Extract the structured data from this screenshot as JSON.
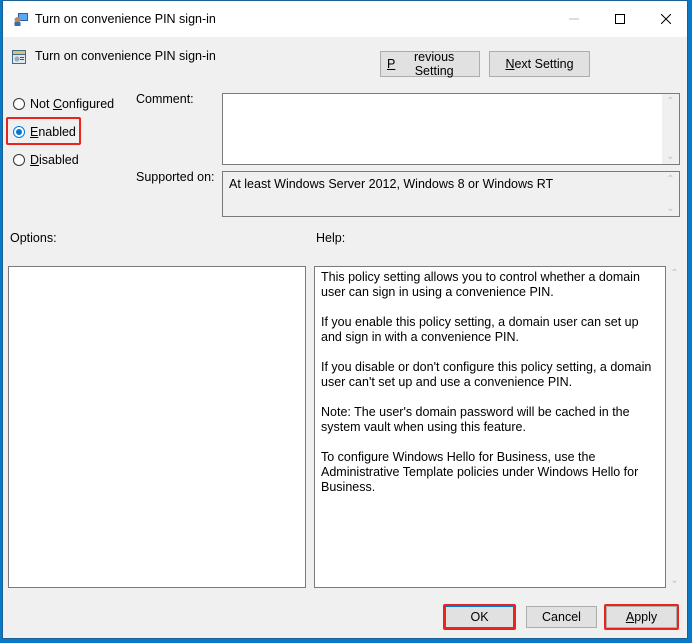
{
  "window": {
    "title": "Turn on convenience PIN sign-in",
    "title_icon": "policy-editor-icon",
    "controls": {
      "minimize": "minimize-icon",
      "maximize": "maximize-icon",
      "close": "close-icon"
    }
  },
  "header": {
    "title": "Turn on convenience PIN sign-in",
    "icon": "policy-setting-icon",
    "previous_label_prefix": "P",
    "previous_label_rest": "revious Setting",
    "next_label_prefix": "N",
    "next_label_rest": "ext Setting"
  },
  "state": {
    "options": [
      {
        "prefix": "Not ",
        "accel": "C",
        "rest": "onfigured",
        "checked": false
      },
      {
        "prefix": "",
        "accel": "E",
        "rest": "nabled",
        "checked": true
      },
      {
        "prefix": "",
        "accel": "D",
        "rest": "isabled",
        "checked": false
      }
    ]
  },
  "labels": {
    "comment": "Comment:",
    "supported_on": "Supported on:",
    "options": "Options:",
    "help": "Help:"
  },
  "comment_value": "",
  "supported_on_value": "At least Windows Server 2012, Windows 8 or Windows RT",
  "help_paragraphs": [
    "This policy setting allows you to control whether a domain user can sign in using a convenience PIN.",
    "If you enable this policy setting, a domain user can set up and sign in with a convenience PIN.",
    "If you disable or don't configure this policy setting, a domain user can't set up and use a convenience PIN.",
    "Note: The user's domain password will be cached in the system vault when using this feature.",
    "To configure Windows Hello for Business, use the Administrative Template policies under Windows Hello for Business."
  ],
  "footer": {
    "ok": "OK",
    "cancel": "Cancel",
    "apply_accel": "A",
    "apply_rest": "pply"
  },
  "colors": {
    "accent": "#0078d7",
    "highlight": "#e8241c",
    "desktop": "#0a7ac8"
  }
}
